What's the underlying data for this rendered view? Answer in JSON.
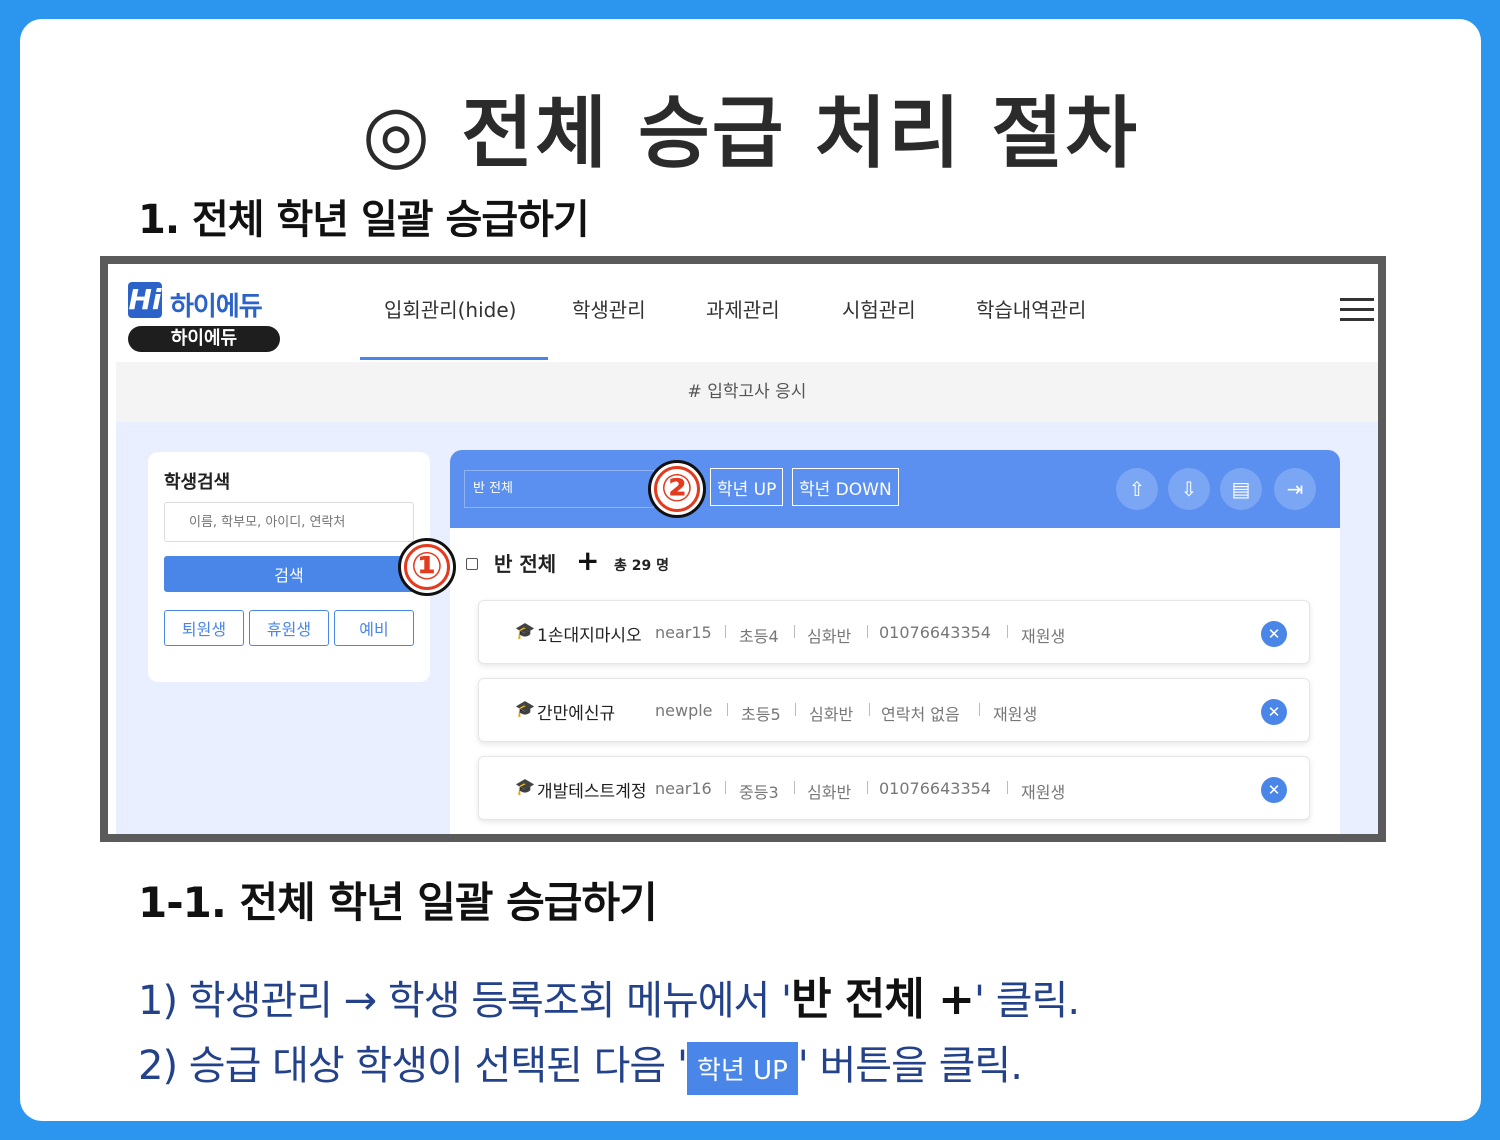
{
  "page_title": "◎ 전체 승급 처리 절차",
  "section1": "1. 전체 학년 일괄 승급하기",
  "section2": "1-1. 전체 학년 일괄 승급하기",
  "screenshot": {
    "logo_mark": "Hi",
    "logo_name": "하이에듀",
    "logo_sub": "하이에듀",
    "nav": [
      "입회관리(hide)",
      "학생관리",
      "과제관리",
      "시험관리",
      "학습내역관리"
    ],
    "subbar": "# 입학고사 응시",
    "search": {
      "title": "학생검색",
      "placeholder": "이름, 학부모, 아이디, 연락처",
      "button": "검색",
      "filters": [
        "퇴원생",
        "휴원생",
        "예비"
      ]
    },
    "list": {
      "class_select": "반 전체",
      "grade_up": "학년 UP",
      "grade_down": "학년 DOWN",
      "icons": [
        "upload-cloud-icon",
        "download-cloud-icon",
        "presentation-icon",
        "logout-icon"
      ],
      "all_label": "반 전체",
      "plus": "+",
      "total": "총 29 명",
      "rows": [
        {
          "name": "1손대지마시오",
          "id": "near15",
          "grade": "초등4",
          "class": "심화반",
          "phone": "01076643354",
          "status": "재원생"
        },
        {
          "name": "간만에신규",
          "id": "newple",
          "grade": "초등5",
          "class": "심화반",
          "phone": "연락처 없음",
          "status": "재원생"
        },
        {
          "name": "개발테스트계정",
          "id": "near16",
          "grade": "중등3",
          "class": "심화반",
          "phone": "01076643354",
          "status": "재원생"
        }
      ]
    },
    "markers": [
      "①",
      "②"
    ]
  },
  "steps": {
    "step1_pre": "1) 학생관리 → 학생 등록조회 메뉴에서 '",
    "step1_hl": "반 전체  +",
    "step1_post": "' 클릭.",
    "step2_pre": "2) 승급 대상 학생이 선택된 다음 '",
    "step2_btn": "학년 UP",
    "step2_post": "' 버튼을 클릭."
  },
  "colors": {
    "accent": "#4a86e8",
    "frame": "#2c96ee",
    "marker": "#e23b1f"
  }
}
